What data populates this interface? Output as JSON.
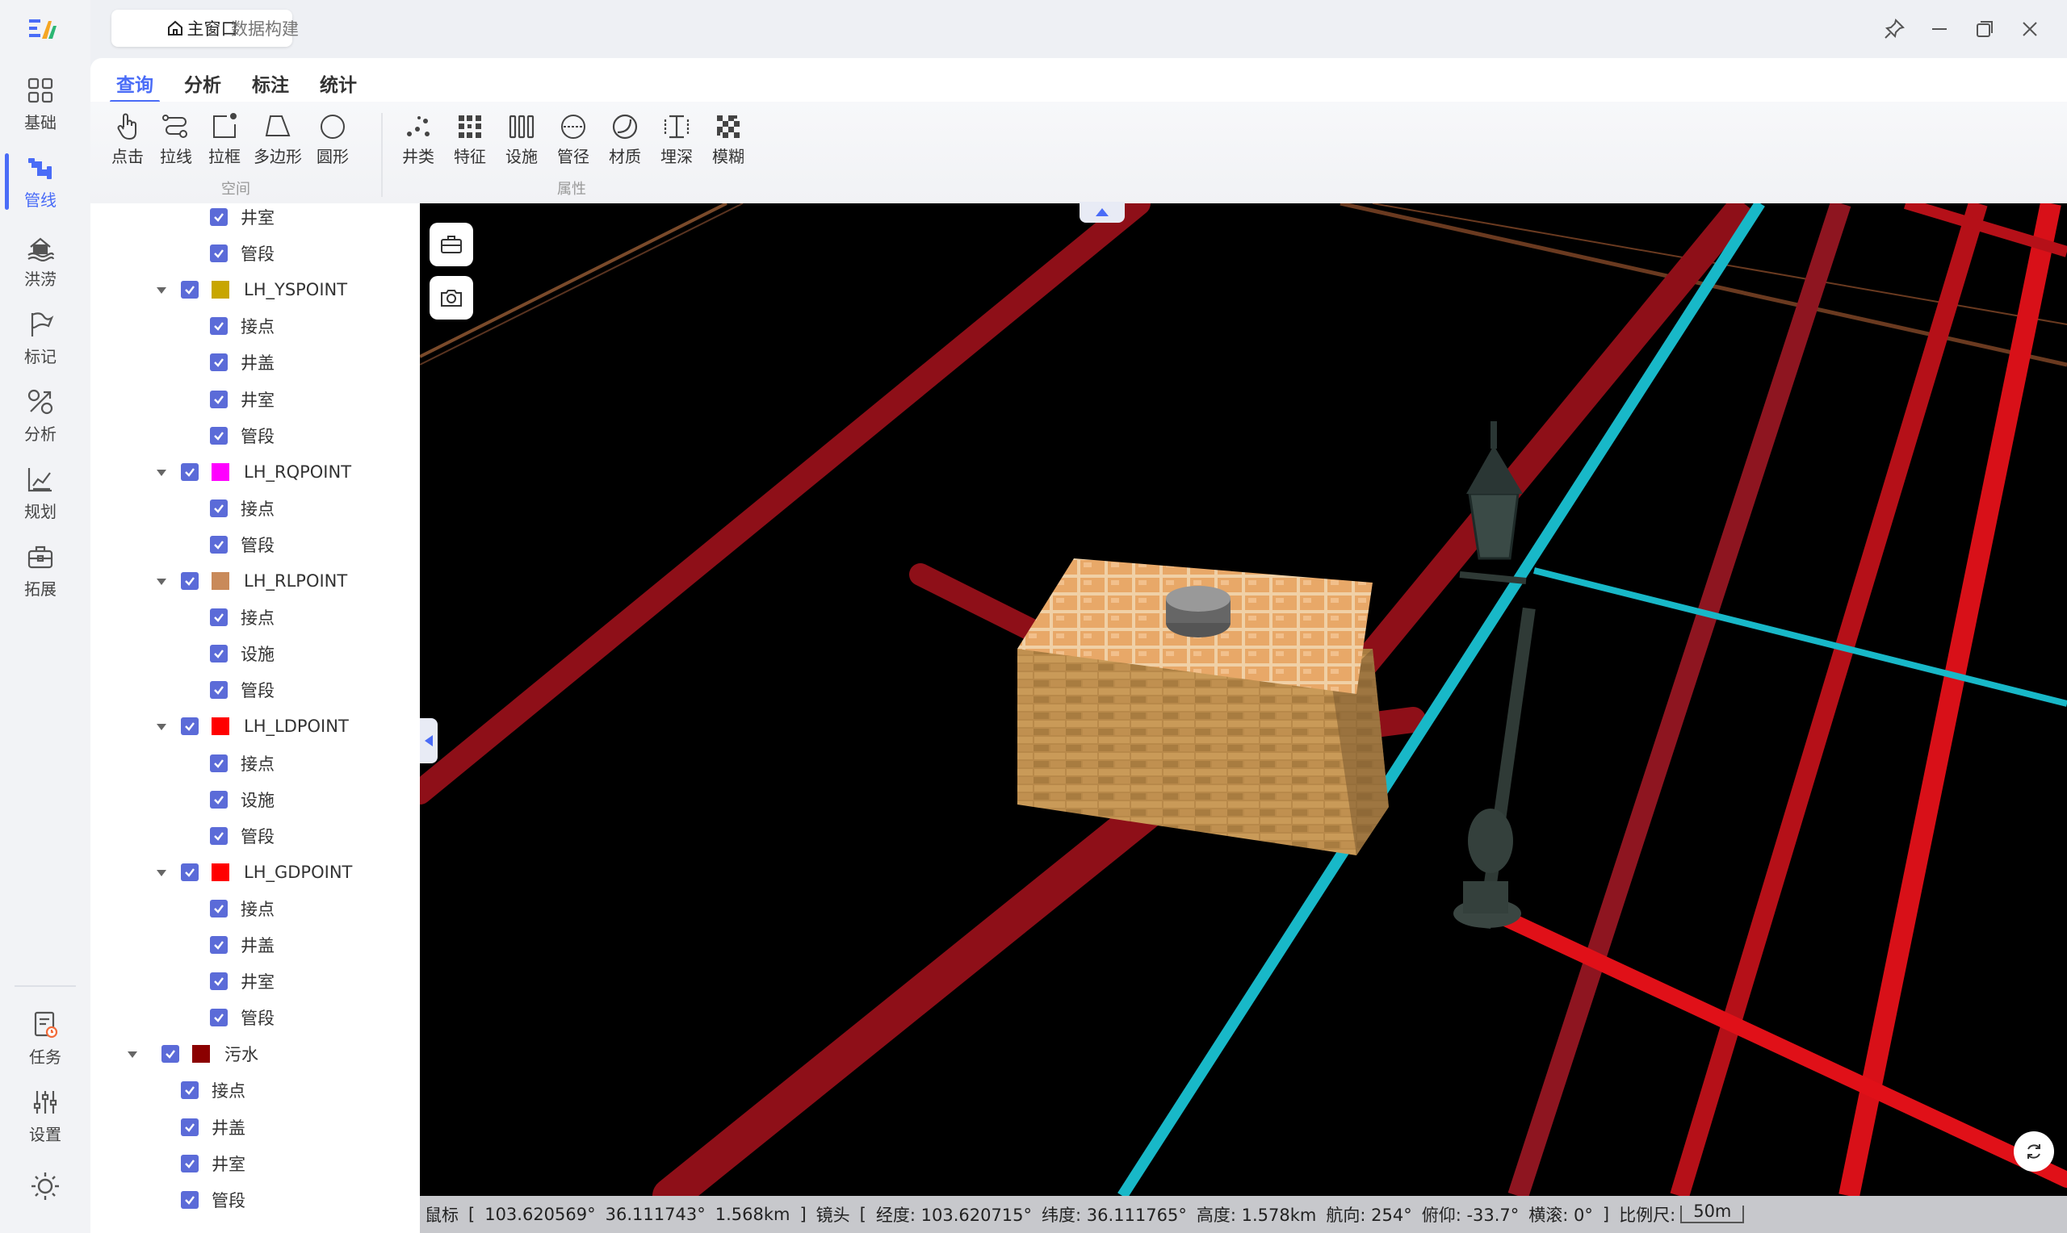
{
  "window": {
    "tabs": [
      {
        "label": "主窗口"
      },
      {
        "label": "数据构建"
      }
    ]
  },
  "rail": {
    "items": [
      {
        "label": "基础",
        "icon": "grid-icon"
      },
      {
        "label": "管线",
        "icon": "pipe-icon",
        "active": true
      },
      {
        "label": "洪涝",
        "icon": "flood-icon"
      },
      {
        "label": "标记",
        "icon": "flag-icon"
      },
      {
        "label": "分析",
        "icon": "analysis-icon"
      },
      {
        "label": "规划",
        "icon": "plan-icon"
      },
      {
        "label": "拓展",
        "icon": "toolbox-icon"
      }
    ],
    "bottom": [
      {
        "label": "任务",
        "icon": "task-icon"
      },
      {
        "label": "设置",
        "icon": "sliders-icon"
      }
    ],
    "accent": "#4a6cf7"
  },
  "ribbon": {
    "tabs": [
      "查询",
      "分析",
      "标注",
      "统计"
    ],
    "spatial": {
      "group_label": "空间",
      "tools": [
        "点击",
        "拉线",
        "拉框",
        "多边形",
        "圆形"
      ]
    },
    "attribute": {
      "group_label": "属性",
      "tools": [
        "井类",
        "特征",
        "设施",
        "管径",
        "材质",
        "埋深",
        "模糊"
      ]
    }
  },
  "tree": {
    "rows": [
      {
        "label": "井室",
        "level": 2
      },
      {
        "label": "管段",
        "level": 2
      },
      {
        "label": "LH_YSPOINT",
        "level": 1,
        "color": "#c8a600"
      },
      {
        "label": "接点",
        "level": 2
      },
      {
        "label": "井盖",
        "level": 2
      },
      {
        "label": "井室",
        "level": 2
      },
      {
        "label": "管段",
        "level": 2
      },
      {
        "label": "LH_RQPOINT",
        "level": 1,
        "color": "#ff00ff"
      },
      {
        "label": "接点",
        "level": 2
      },
      {
        "label": "管段",
        "level": 2
      },
      {
        "label": "LH_RLPOINT",
        "level": 1,
        "color": "#c98a5a"
      },
      {
        "label": "接点",
        "level": 2
      },
      {
        "label": "设施",
        "level": 2
      },
      {
        "label": "管段",
        "level": 2
      },
      {
        "label": "LH_LDPOINT",
        "level": 1,
        "color": "#ff0000"
      },
      {
        "label": "接点",
        "level": 2
      },
      {
        "label": "设施",
        "level": 2
      },
      {
        "label": "管段",
        "level": 2
      },
      {
        "label": "LH_GDPOINT",
        "level": 1,
        "color": "#ff0000"
      },
      {
        "label": "接点",
        "level": 2
      },
      {
        "label": "井盖",
        "level": 2
      },
      {
        "label": "井室",
        "level": 2
      },
      {
        "label": "管段",
        "level": 2
      },
      {
        "label": "污水",
        "level": 0,
        "color": "#8b0000"
      },
      {
        "label": "接点",
        "level": 1
      },
      {
        "label": "井盖",
        "level": 1
      },
      {
        "label": "井室",
        "level": 1
      },
      {
        "label": "管段",
        "level": 1
      }
    ]
  },
  "status": {
    "mouse_label": "鼠标",
    "mouse_lon": "103.620569°",
    "mouse_lat": "36.111743°",
    "mouse_alt": "1.568km",
    "camera_label": "镜头",
    "cam_lon": "经度: 103.620715°",
    "cam_lat": "纬度: 36.111765°",
    "cam_alt": "高度: 1.578km",
    "heading": "航向: 254°",
    "pitch": "俯仰: -33.7°",
    "roll": "横滚: 0°",
    "scale_label": "比例尺:",
    "scale_value": "50m"
  }
}
